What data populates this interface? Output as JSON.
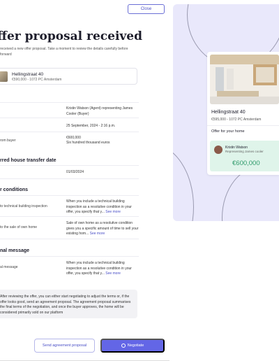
{
  "header": {
    "close_label": "Close"
  },
  "page": {
    "title": "ffer proposal received",
    "subtitle": "received a new offer proposal. Take a moment to review the details carefully before forward"
  },
  "property": {
    "name": "Hellingstraat 40",
    "price": "€590,000 - 1072 PC Amsterdam"
  },
  "details": {
    "rows": [
      {
        "label": "",
        "value": "Kristin Watson (Agent) representing James Cooler (Buyer)"
      },
      {
        "label": "",
        "value": "25 September, 2024 - 2:16 p.m."
      },
      {
        "label": "rom buyer",
        "value": "€600,000",
        "value2": "Six hundred thousand euros"
      }
    ]
  },
  "transfer": {
    "heading": "rred house transfer date",
    "value": "01/03/2024"
  },
  "conditions": {
    "heading": "r conditions",
    "items": [
      {
        "label": "to technical building inspection",
        "text": "When you include a technical building inspection as a resolutive condition in your offer, you specify that y...",
        "link": "See more"
      },
      {
        "label": "to the sale of own home",
        "text": "Sale of own home as a resolutive condition gives you a specific amount of time to sell your existing hom...",
        "link": "See more"
      }
    ]
  },
  "message": {
    "heading": "nal message",
    "label": "al message",
    "text": "When you include a technical building inspection as a resolutive condition in your offer, you specify that y...",
    "link": "See more"
  },
  "info": {
    "text": "After reviewing the offer, you can either start negotiating to adjust the terms or, if the offer looks good, send an agreement proposal. The agreement proposal summarises the final terms of the negotiation, and once the buyer approves, the home will be considered primarily sold on our platform"
  },
  "actions": {
    "agreement_label": "Send agreement proposal",
    "negotiate_label": "Negotiate"
  },
  "summary": {
    "name": "Hellingstraat 40",
    "price": "€595,000 - 1072 PC Amsterdam",
    "offer_heading": "Offer for your home",
    "agent_name": "Kristin Watson",
    "agent_rep": "Representing James cooler",
    "amount": "€600,000"
  }
}
